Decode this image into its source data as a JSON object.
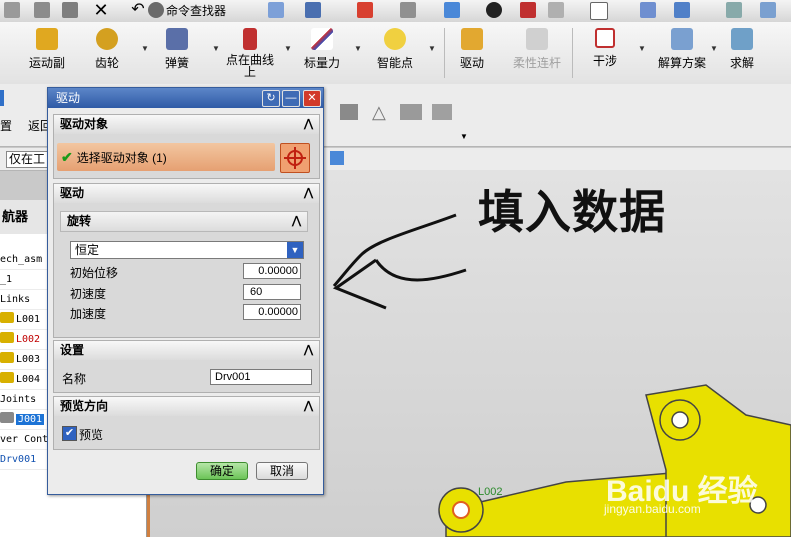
{
  "toolbar": {
    "command_finder_label": "命令查找器"
  },
  "ribbon": {
    "items": [
      {
        "label": "运动副",
        "disabled": false
      },
      {
        "label": "齿轮",
        "disabled": false
      },
      {
        "label": "弹簧",
        "disabled": false
      },
      {
        "label": "点在曲线上",
        "disabled": false
      },
      {
        "label": "标量力",
        "disabled": false
      },
      {
        "label": "智能点",
        "disabled": false
      },
      {
        "label": "驱动",
        "disabled": false
      },
      {
        "label": "柔性连杆",
        "disabled": true
      },
      {
        "label": "干涉",
        "disabled": false
      },
      {
        "label": "解算方案",
        "disabled": false
      },
      {
        "label": "求解",
        "disabled": false
      }
    ]
  },
  "row2": {
    "left_label_1": "置",
    "left_label_2": "返回"
  },
  "row3": {
    "filter_value": "仅在工作"
  },
  "navigator": {
    "title": "航器",
    "rows": [
      {
        "text": "ech_asm"
      },
      {
        "text": "_1"
      },
      {
        "text": "Links"
      },
      {
        "text": "L001"
      },
      {
        "text": "L002"
      },
      {
        "text": "L003"
      },
      {
        "text": "L004"
      },
      {
        "text": "Joints"
      },
      {
        "text": "J001"
      },
      {
        "text": "ver Cont"
      },
      {
        "text": "Drv001"
      }
    ]
  },
  "dialog": {
    "title": "驱动",
    "sections": {
      "drive_object": "驱动对象",
      "drive": "驱动",
      "settings": "设置",
      "preview_direction": "预览方向"
    },
    "select_object_label": "选择驱动对象 (1)",
    "rotation": {
      "title": "旋转",
      "mode": "恒定",
      "initial_displacement_label": "初始位移",
      "initial_displacement": "0.00000",
      "initial_velocity_label": "初速度",
      "initial_velocity": "60",
      "acceleration_label": "加速度",
      "acceleration": "0.00000"
    },
    "name_label": "名称",
    "name_value": "Drv001",
    "preview_label": "预览",
    "preview_checked": true,
    "ok_label": "确定",
    "cancel_label": "取消"
  },
  "canvas": {
    "annotation": "填入数据",
    "joint_label": "L002"
  },
  "watermark": {
    "text": "Baidu 经验",
    "url": "jingyan.baidu.com"
  }
}
